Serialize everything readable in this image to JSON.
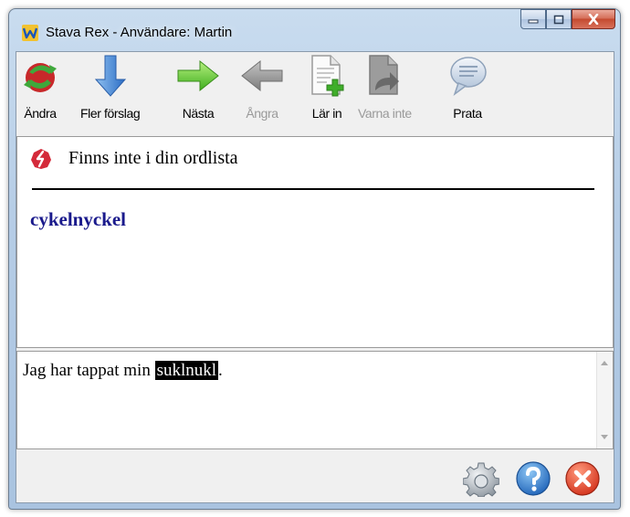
{
  "window": {
    "title": "Stava Rex - Användare: Martin"
  },
  "toolbar": {
    "items": [
      {
        "label": "Ändra",
        "icon": "change-icon",
        "enabled": true
      },
      {
        "label": "Fler förslag",
        "icon": "arrow-down-icon",
        "enabled": true
      },
      {
        "label": "Nästa",
        "icon": "arrow-right-icon",
        "enabled": true
      },
      {
        "label": "Ångra",
        "icon": "arrow-left-icon",
        "enabled": false
      },
      {
        "label": "Lär in",
        "icon": "add-document-icon",
        "enabled": true
      },
      {
        "label": "Varna inte",
        "icon": "ignore-document-icon",
        "enabled": false
      },
      {
        "label": "Prata",
        "icon": "speech-bubble-icon",
        "enabled": true
      }
    ]
  },
  "suggestions": {
    "status_text": "Finns inte i din ordlista",
    "items": [
      "cykelnyckel"
    ]
  },
  "document": {
    "text_before": "Jag har tappat min ",
    "misspelled": "suklnukl",
    "text_after": "."
  },
  "colors": {
    "suggestion": "#1a1a8c",
    "highlight_bg": "#000000",
    "disabled_label": "#9a9a9a"
  }
}
